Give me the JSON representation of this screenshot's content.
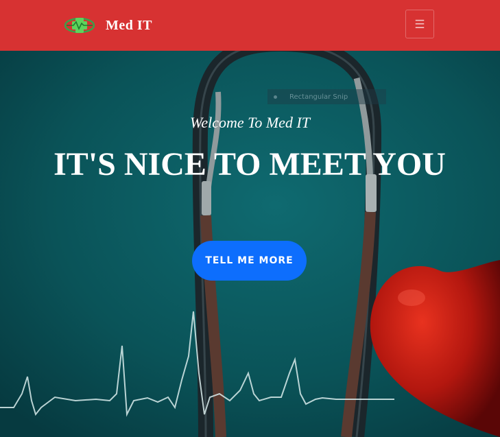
{
  "navbar": {
    "brand_name": "Med IT",
    "logo_icon": "medical-cross-heartbeat-icon",
    "menu_icon": "hamburger-menu-icon",
    "menu_glyph": "☰",
    "background": "#d73232"
  },
  "overlay": {
    "snip_label": "Rectangular Snip"
  },
  "hero": {
    "welcome": "Welcome To Med IT",
    "headline": "IT'S NICE TO MEET YOU",
    "cta_label": "TELL ME MORE",
    "cta_color": "#0d6efd",
    "background_color": "#0a4f54"
  }
}
